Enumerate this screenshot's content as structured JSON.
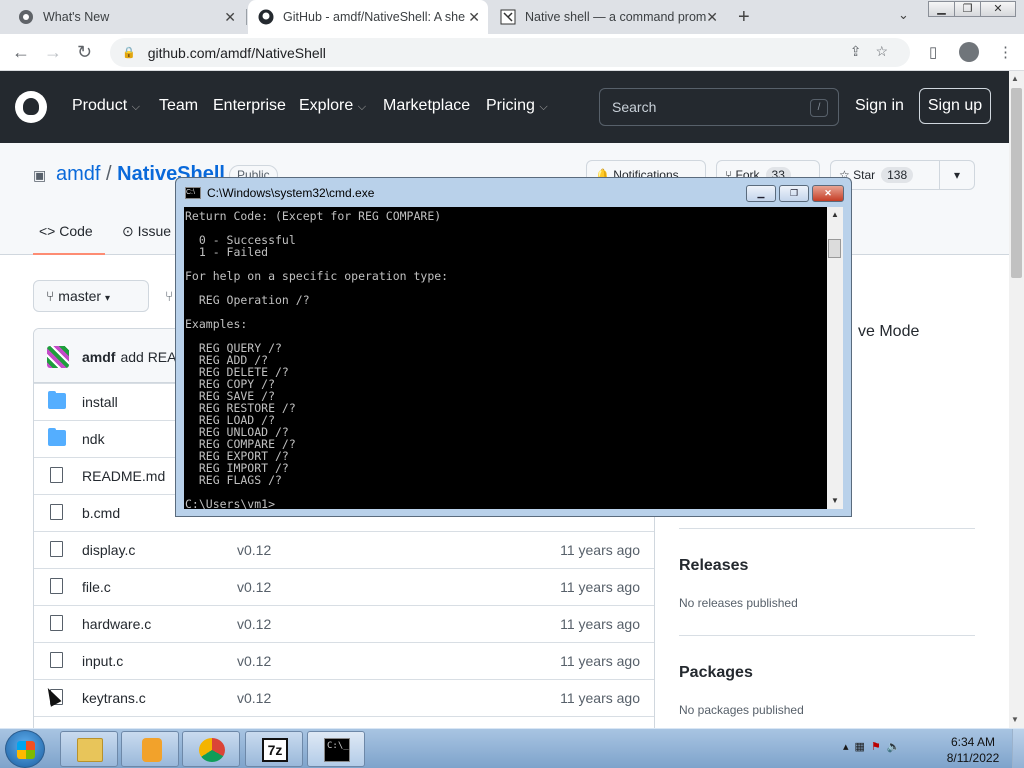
{
  "browser": {
    "tabs": [
      {
        "title": "What's New"
      },
      {
        "title": "GitHub - amdf/NativeShell: A she"
      },
      {
        "title": "Native shell — a command prom"
      }
    ],
    "url": "github.com/amdf/NativeShell"
  },
  "github": {
    "nav": [
      "Product",
      "Team",
      "Enterprise",
      "Explore",
      "Marketplace",
      "Pricing"
    ],
    "search_placeholder": "Search",
    "search_key": "/",
    "sign_in": "Sign in",
    "sign_up": "Sign up",
    "owner": "amdf",
    "sep": "/",
    "repo": "NativeShell",
    "visibility": "Public",
    "notifications": "Notifications",
    "fork": {
      "label": "Fork",
      "count": "33"
    },
    "star": {
      "label": "Star",
      "count": "138"
    },
    "tabs": {
      "code": "Code",
      "issues": "Issue"
    },
    "branch": "master",
    "commit": {
      "author": "amdf",
      "message": "add READ"
    },
    "files": [
      {
        "name": "install",
        "type": "dir",
        "commit": "",
        "age": ""
      },
      {
        "name": "ndk",
        "type": "dir",
        "commit": "",
        "age": ""
      },
      {
        "name": "README.md",
        "type": "file",
        "commit": "",
        "age": ""
      },
      {
        "name": "b.cmd",
        "type": "file",
        "commit": "",
        "age": ""
      },
      {
        "name": "display.c",
        "type": "file",
        "commit": "v0.12",
        "age": "11 years ago"
      },
      {
        "name": "file.c",
        "type": "file",
        "commit": "v0.12",
        "age": "11 years ago"
      },
      {
        "name": "hardware.c",
        "type": "file",
        "commit": "v0.12",
        "age": "11 years ago"
      },
      {
        "name": "input.c",
        "type": "file",
        "commit": "v0.12",
        "age": "11 years ago"
      },
      {
        "name": "keytrans.c",
        "type": "file",
        "commit": "v0.12",
        "age": "11 years ago"
      }
    ],
    "about_fragment": "ve Mode",
    "releases": {
      "heading": "Releases",
      "text": "No releases published"
    },
    "packages": {
      "heading": "Packages",
      "text": "No packages published"
    }
  },
  "cmd": {
    "title": "C:\\Windows\\system32\\cmd.exe",
    "output": "Return Code: (Except for REG COMPARE)\n\n  0 - Successful\n  1 - Failed\n\nFor help on a specific operation type:\n\n  REG Operation /?\n\nExamples:\n\n  REG QUERY /?\n  REG ADD /?\n  REG DELETE /?\n  REG COPY /?\n  REG SAVE /?\n  REG RESTORE /?\n  REG LOAD /?\n  REG UNLOAD /?\n  REG COMPARE /?\n  REG EXPORT /?\n  REG IMPORT /?\n  REG FLAGS /?\n\nC:\\Users\\vm1>"
  },
  "taskbar": {
    "time": "6:34 AM",
    "date": "8/11/2022",
    "sevenzip_label": "7z",
    "cmd_label": "C:\\_"
  }
}
